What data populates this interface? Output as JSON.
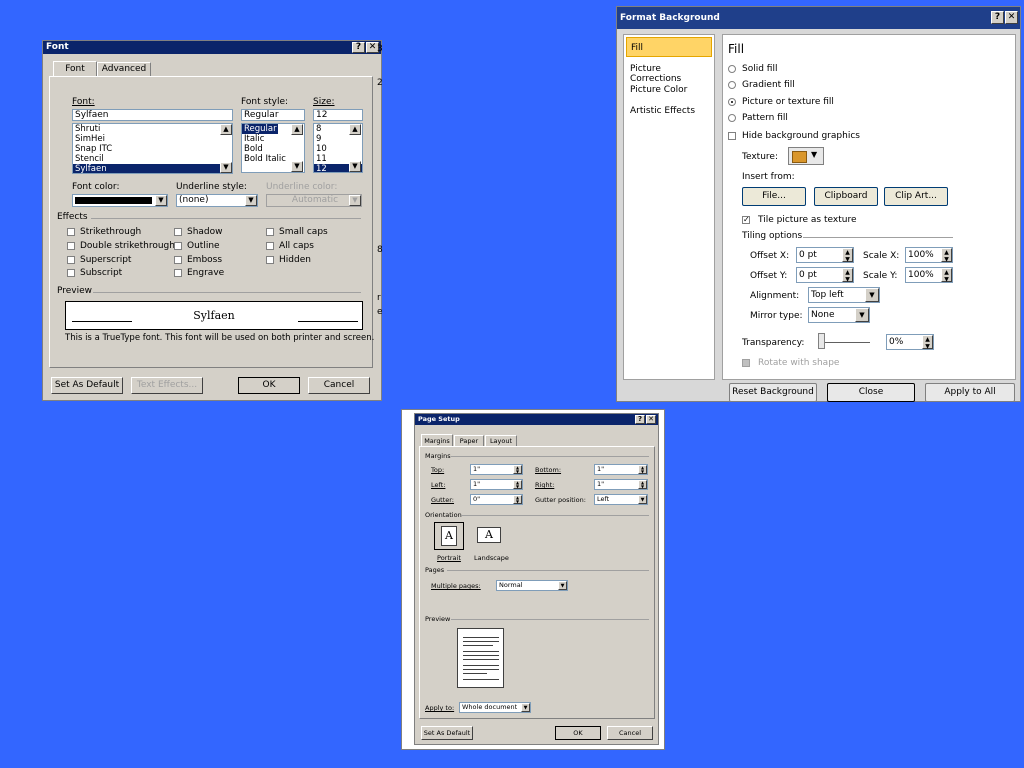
{
  "font_dialog": {
    "title": "Font",
    "tabs": [
      "Font",
      "Advanced"
    ],
    "font_label": "Font:",
    "font_value": "Sylfaen",
    "font_list": [
      "Shruti",
      "SimHei",
      "Snap ITC",
      "Stencil",
      "Sylfaen"
    ],
    "style_label": "Font style:",
    "style_value": "Regular",
    "style_list": [
      "Regular",
      "Italic",
      "Bold",
      "Bold Italic"
    ],
    "size_label": "Size:",
    "size_value": "12",
    "size_list": [
      "8",
      "9",
      "10",
      "11",
      "12"
    ],
    "font_color_label": "Font color:",
    "underline_style_label": "Underline style:",
    "underline_style_value": "(none)",
    "underline_color_label": "Underline color:",
    "underline_color_value": "Automatic",
    "effects_label": "Effects",
    "effects": [
      "Strikethrough",
      "Double strikethrough",
      "Superscript",
      "Subscript",
      "Shadow",
      "Outline",
      "Emboss",
      "Engrave",
      "Small caps",
      "All caps",
      "Hidden"
    ],
    "preview_label": "Preview",
    "preview_text": "Sylfaen",
    "note": "This is a TrueType font. This font will be used on both printer and screen.",
    "set_default_label": "Set As Default",
    "text_effects_label": "Text Effects...",
    "ok_label": "OK",
    "cancel_label": "Cancel",
    "help_glyph": "?",
    "close_glyph": "✕",
    "side_chars": [
      "3",
      "2",
      "8",
      "r",
      "e"
    ]
  },
  "format_background": {
    "title": "Format Background",
    "nav": [
      "Fill",
      "Picture Corrections",
      "Picture Color",
      "Artistic Effects"
    ],
    "heading": "Fill",
    "fill_options": [
      "Solid fill",
      "Gradient fill",
      "Picture or texture fill",
      "Pattern fill"
    ],
    "hide_graphics_label": "Hide background graphics",
    "texture_label": "Texture:",
    "insert_from_label": "Insert from:",
    "file_btn": "File...",
    "clipboard_btn": "Clipboard",
    "clipart_btn": "Clip Art...",
    "tile_label": "Tile picture as texture",
    "tiling_label": "Tiling options",
    "offset_x_label": "Offset X:",
    "offset_x_value": "0 pt",
    "scale_x_label": "Scale X:",
    "scale_x_value": "100%",
    "offset_y_label": "Offset Y:",
    "offset_y_value": "0 pt",
    "scale_y_label": "Scale Y:",
    "scale_y_value": "100%",
    "alignment_label": "Alignment:",
    "alignment_value": "Top left",
    "mirror_label": "Mirror type:",
    "mirror_value": "None",
    "transparency_label": "Transparency:",
    "transparency_value": "0%",
    "rotate_label": "Rotate with shape",
    "reset_btn": "Reset Background",
    "close_btn": "Close",
    "apply_all_btn": "Apply to All"
  },
  "page_setup": {
    "title": "Page Setup",
    "tabs": [
      "Margins",
      "Paper",
      "Layout"
    ],
    "margins_label": "Margins",
    "top_label": "Top:",
    "top_value": "1\"",
    "bottom_label": "Bottom:",
    "bottom_value": "1\"",
    "left_label": "Left:",
    "left_value": "1\"",
    "right_label": "Right:",
    "right_value": "1\"",
    "gutter_label": "Gutter:",
    "gutter_value": "0\"",
    "gutter_pos_label": "Gutter position:",
    "gutter_pos_value": "Left",
    "orientation_label": "Orientation",
    "portrait_label": "Portrait",
    "landscape_label": "Landscape",
    "orientation_glyph": "A",
    "pages_label": "Pages",
    "multiple_pages_label": "Multiple pages:",
    "multiple_pages_value": "Normal",
    "preview_label": "Preview",
    "apply_to_label": "Apply to:",
    "apply_to_value": "Whole document",
    "set_default_label": "Set As Default",
    "ok_label": "OK",
    "cancel_label": "Cancel"
  }
}
